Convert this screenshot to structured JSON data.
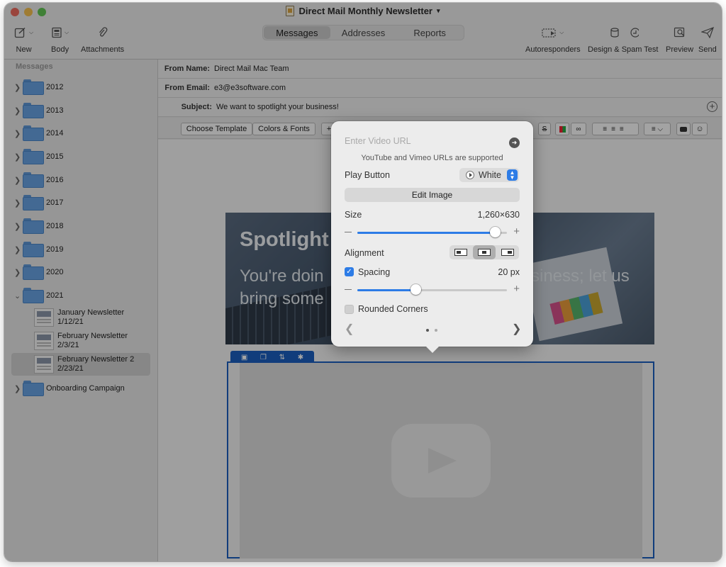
{
  "window": {
    "title": "Direct Mail Monthly Newsletter"
  },
  "toolbar": {
    "new_label": "New",
    "body_label": "Body",
    "attachments_label": "Attachments",
    "tabs": [
      {
        "label": "Messages"
      },
      {
        "label": "Addresses"
      },
      {
        "label": "Reports"
      }
    ],
    "autoresponders_label": "Autoresponders",
    "design_spam_label": "Design & Spam Test",
    "preview_label": "Preview",
    "send_label": "Send"
  },
  "sidebar": {
    "header": "Messages",
    "folders": [
      {
        "name": "2012"
      },
      {
        "name": "2013"
      },
      {
        "name": "2014"
      },
      {
        "name": "2015"
      },
      {
        "name": "2016"
      },
      {
        "name": "2017"
      },
      {
        "name": "2018"
      },
      {
        "name": "2019"
      },
      {
        "name": "2020"
      },
      {
        "name": "2021"
      }
    ],
    "messages": [
      {
        "title": "January Newsletter",
        "date": "1/12/21"
      },
      {
        "title": "February Newsletter",
        "date": "2/3/21"
      },
      {
        "title": "February Newsletter 2",
        "date": "2/23/21"
      }
    ],
    "onboarding": "Onboarding Campaign"
  },
  "header": {
    "from_name_label": "From Name:",
    "from_name": "Direct Mail Mac Team",
    "from_email_label": "From Email:",
    "from_email": "e3@e3software.com",
    "subject_label": "Subject:",
    "subject": "We want to spotlight your business!"
  },
  "format_bar": {
    "choose_template": "Choose Template",
    "colors_fonts": "Colors & Fonts"
  },
  "content": {
    "heading": "Spotlight",
    "subheading_left": "You're doin",
    "subheading_right": "siness; let us",
    "subheading_line2": "bring some"
  },
  "popover": {
    "url_placeholder": "Enter Video URL",
    "url_note": "YouTube and Vimeo URLs are supported",
    "play_button_label": "Play Button",
    "play_button_value": "White",
    "edit_image_label": "Edit Image",
    "size_label": "Size",
    "size_value": "1,260×630",
    "size_slider_fraction": 0.92,
    "alignment_label": "Alignment",
    "alignment_selected": "center",
    "spacing_label": "Spacing",
    "spacing_checked": true,
    "spacing_value": "20 px",
    "spacing_slider_fraction": 0.39,
    "rounded_corners_label": "Rounded Corners",
    "rounded_corners_checked": false,
    "page_current": 1,
    "page_count": 2
  },
  "colors": {
    "accent": "#2d7ce6",
    "selection_border": "#1b5fbf"
  }
}
